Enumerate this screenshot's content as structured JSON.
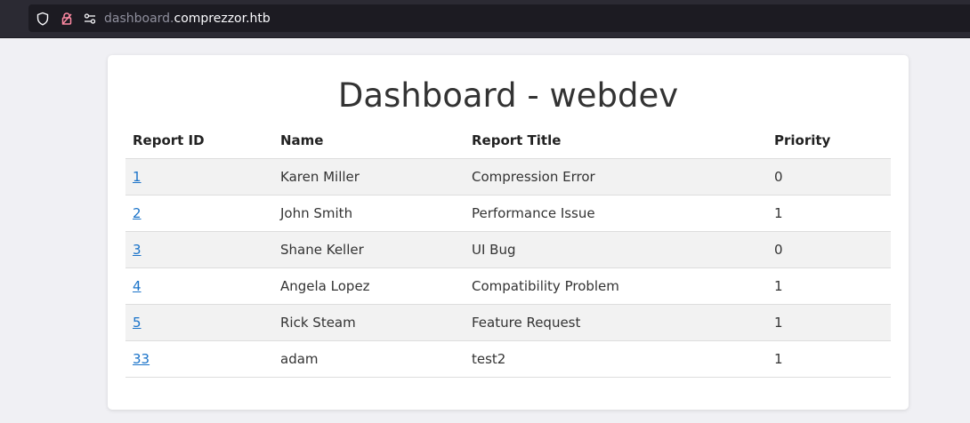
{
  "browser": {
    "url_subdomain": "dashboard.",
    "url_domain": "comprezzor.htb"
  },
  "page": {
    "title": "Dashboard - webdev"
  },
  "table": {
    "headers": {
      "id": "Report ID",
      "name": "Name",
      "title": "Report Title",
      "priority": "Priority"
    },
    "rows": [
      {
        "id": "1",
        "name": "Karen Miller",
        "title": "Compression Error",
        "priority": "0"
      },
      {
        "id": "2",
        "name": "John Smith",
        "title": "Performance Issue",
        "priority": "1"
      },
      {
        "id": "3",
        "name": "Shane Keller",
        "title": "UI Bug",
        "priority": "0"
      },
      {
        "id": "4",
        "name": "Angela Lopez",
        "title": "Compatibility Problem",
        "priority": "1"
      },
      {
        "id": "5",
        "name": "Rick Steam",
        "title": "Feature Request",
        "priority": "1"
      },
      {
        "id": "33",
        "name": "adam",
        "title": "test2",
        "priority": "1"
      }
    ]
  },
  "icons": {
    "shield": "shield-icon",
    "lock": "lock-icon",
    "permissions": "permissions-icon"
  },
  "colors": {
    "link": "#1a73c9",
    "stripe": "#f2f2f2",
    "page_background": "#f0f0f4"
  }
}
